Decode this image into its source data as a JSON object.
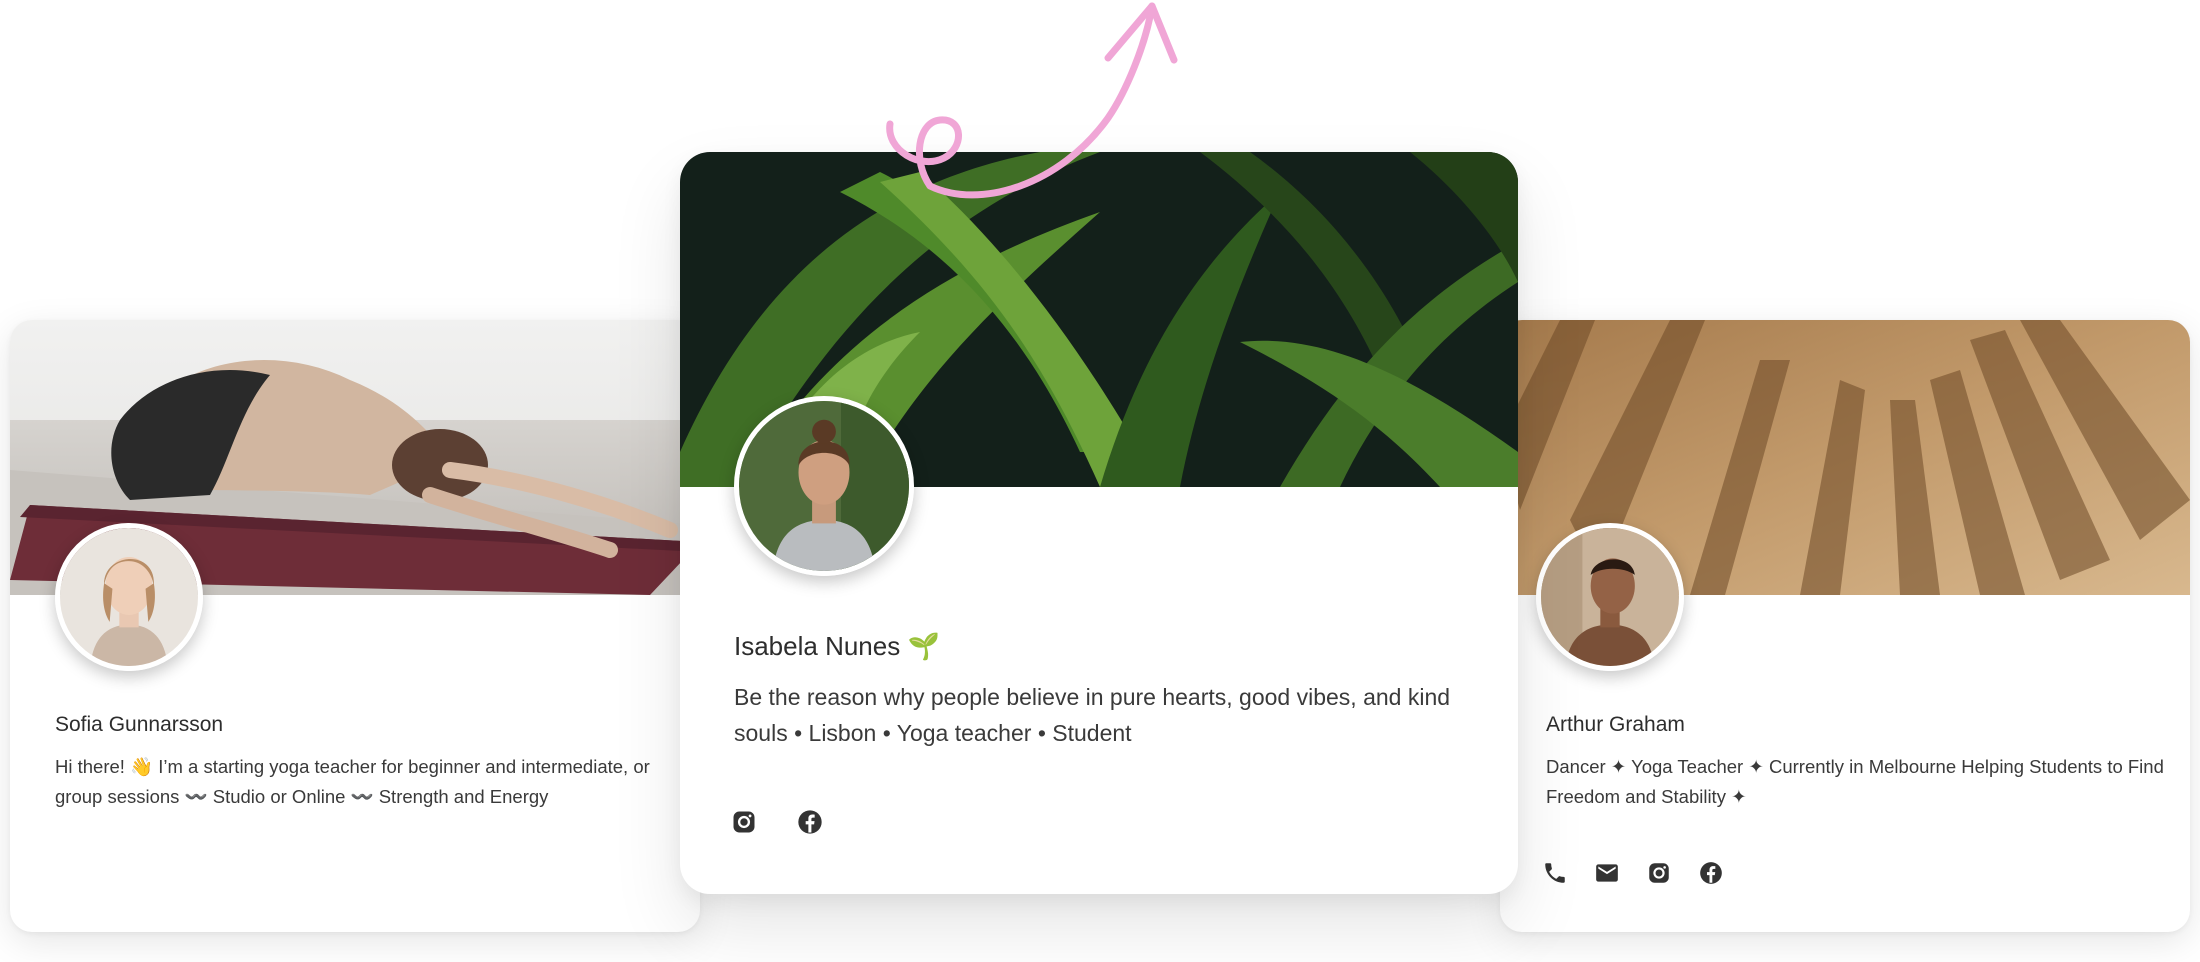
{
  "cards": {
    "left": {
      "name": "Sofia Gunnarsson",
      "bio": "Hi there! 👋 I’m a starting yoga teacher for beginner and intermediate, or group sessions 〰️ Studio or Online 〰️ Strength and Energy",
      "cover": "yoga child's pose on mat",
      "avatar": "portrait woman"
    },
    "center": {
      "name": "Isabela Nunes",
      "name_emoji": "🌱",
      "bio": "Be the reason why people believe in pure hearts, good vibes, and kind souls • Lisbon • Yoga teacher • Student",
      "cover": "green leaves",
      "avatar": "portrait woman",
      "socials": [
        "instagram-icon",
        "facebook-icon"
      ]
    },
    "right": {
      "name": "Arthur Graham",
      "bio": "Dancer ✦ Yoga Teacher ✦ Currently in Melbourne Helping Students to Find Freedom and Stability ✦",
      "cover": "palm shadows on sand",
      "avatar": "portrait man",
      "socials": [
        "phone-icon",
        "mail-icon",
        "instagram-icon",
        "facebook-icon"
      ]
    }
  },
  "colors": {
    "accent_arrow": "#f0a6d6",
    "text": "#2d2d2d",
    "icon": "#333333"
  }
}
